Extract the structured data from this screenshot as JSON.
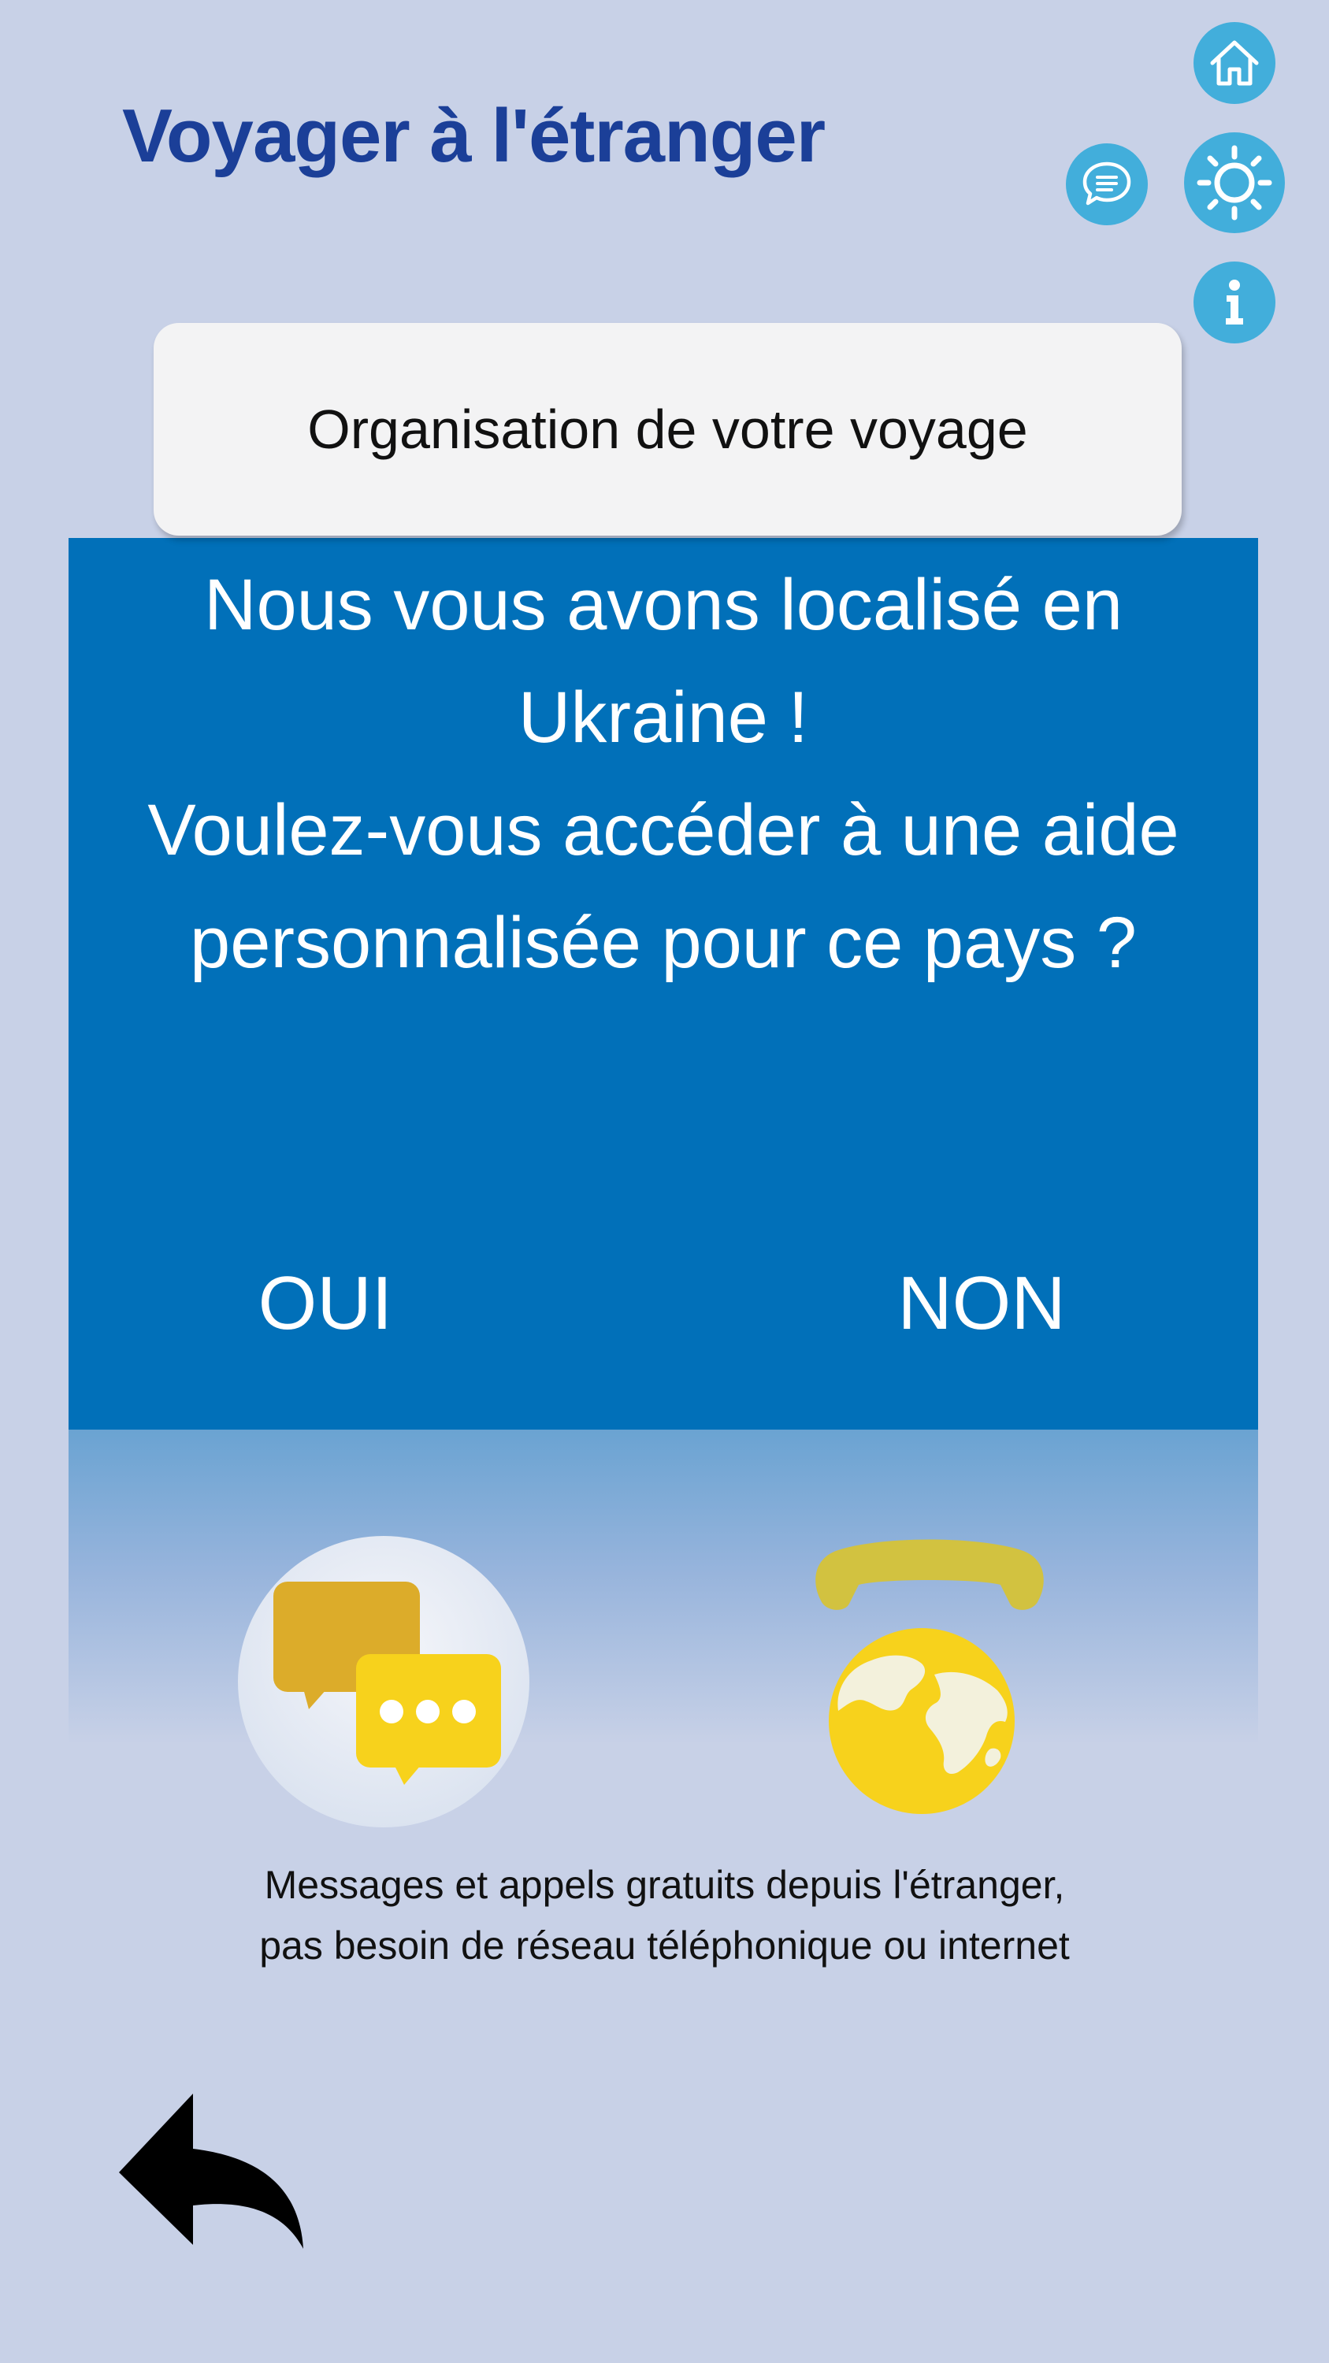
{
  "header": {
    "title": "Voyager à l'étranger"
  },
  "toolbar": {
    "home_icon": "home-icon",
    "chat_icon": "chat-bubble-icon",
    "settings_icon": "brightness-icon",
    "info_icon": "info-icon"
  },
  "section": {
    "title": "Organisation de votre voyage"
  },
  "modal": {
    "message_lines": [
      "Nous vous avons localisé en",
      "Ukraine !",
      "Voulez-vous accéder à une aide",
      "personnalisée pour ce pays ?"
    ],
    "yes_label": "OUI",
    "no_label": "NON"
  },
  "features": {
    "messages_icon": "chat-bubbles-icon",
    "calls_icon": "phone-globe-icon",
    "description_lines": [
      "Messages et appels gratuits depuis l'étranger,",
      "pas besoin de réseau téléphonique ou internet"
    ]
  },
  "navigation": {
    "back_icon": "back-arrow-icon"
  },
  "colors": {
    "background": "#c8d1e7",
    "title": "#1b3f98",
    "icon_button": "#42aedb",
    "modal": "#0170b9",
    "card": "#f3f3f4",
    "accent_yellow": "#f7d21c"
  }
}
